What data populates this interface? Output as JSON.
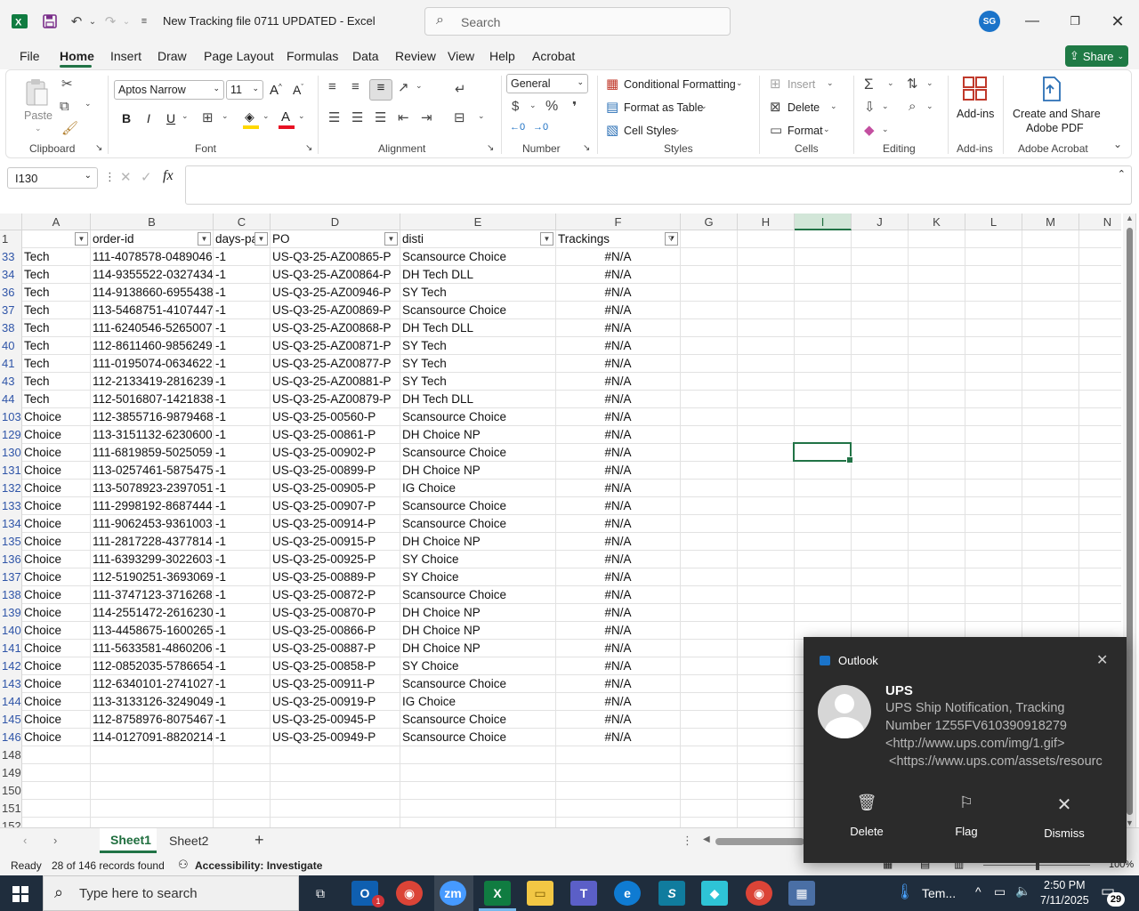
{
  "window": {
    "title": "New Tracking file 0711 UPDATED  -  Excel",
    "search_placeholder": "Search",
    "user_initials": "SG"
  },
  "menu": {
    "tabs": [
      "File",
      "Home",
      "Insert",
      "Draw",
      "Page Layout",
      "Formulas",
      "Data",
      "Review",
      "View",
      "Help",
      "Acrobat"
    ],
    "share_label": "Share"
  },
  "ribbon": {
    "clipboard": {
      "paste": "Paste",
      "label": "Clipboard"
    },
    "font": {
      "name": "Aptos Narrow",
      "size": "11",
      "label": "Font",
      "bold": "B",
      "italic": "I",
      "underline": "U"
    },
    "alignment": {
      "label": "Alignment"
    },
    "number": {
      "format": "General",
      "label": "Number"
    },
    "styles": {
      "conditional": "Conditional Formatting",
      "format_table": "Format as Table",
      "cell_styles": "Cell Styles",
      "label": "Styles"
    },
    "cells": {
      "insert": "Insert",
      "delete": "Delete",
      "format": "Format",
      "label": "Cells"
    },
    "editing": {
      "label": "Editing"
    },
    "addins": {
      "button": "Add-ins",
      "label": "Add-ins"
    },
    "acrobat": {
      "button_line1": "Create and Share",
      "button_line2": "Adobe PDF",
      "label": "Adobe Acrobat"
    }
  },
  "formula_bar": {
    "name_box": "I130",
    "fx": "fx",
    "value": ""
  },
  "grid": {
    "columns": [
      "A",
      "B",
      "C",
      "D",
      "E",
      "F",
      "G",
      "H",
      "I",
      "J",
      "K",
      "L",
      "M",
      "N"
    ],
    "selected_column": "I",
    "header_row": {
      "row": "1",
      "A": "",
      "B": "order-id",
      "C": "days-pa",
      "D": "PO",
      "E": "disti",
      "F": "Trackings"
    },
    "rows": [
      {
        "n": "33",
        "a": "Tech",
        "b": "111-4078578-0489046",
        "c": "-1",
        "d": "US-Q3-25-AZ00865-P",
        "e": "Scansource Choice",
        "f": "#N/A"
      },
      {
        "n": "34",
        "a": "Tech",
        "b": "114-9355522-0327434",
        "c": "-1",
        "d": "US-Q3-25-AZ00864-P",
        "e": "DH Tech DLL",
        "f": "#N/A"
      },
      {
        "n": "36",
        "a": "Tech",
        "b": "114-9138660-6955438",
        "c": "-1",
        "d": "US-Q3-25-AZ00946-P",
        "e": "SY Tech",
        "f": "#N/A"
      },
      {
        "n": "37",
        "a": "Tech",
        "b": "113-5468751-4107447",
        "c": "-1",
        "d": "US-Q3-25-AZ00869-P",
        "e": "Scansource Choice",
        "f": "#N/A"
      },
      {
        "n": "38",
        "a": "Tech",
        "b": "111-6240546-5265007",
        "c": "-1",
        "d": "US-Q3-25-AZ00868-P",
        "e": "DH Tech DLL",
        "f": "#N/A"
      },
      {
        "n": "40",
        "a": "Tech",
        "b": "112-8611460-9856249",
        "c": "-1",
        "d": "US-Q3-25-AZ00871-P",
        "e": "SY Tech",
        "f": "#N/A"
      },
      {
        "n": "41",
        "a": "Tech",
        "b": "111-0195074-0634622",
        "c": "-1",
        "d": "US-Q3-25-AZ00877-P",
        "e": "SY Tech",
        "f": "#N/A"
      },
      {
        "n": "43",
        "a": "Tech",
        "b": "112-2133419-2816239",
        "c": "-1",
        "d": "US-Q3-25-AZ00881-P",
        "e": "SY Tech",
        "f": "#N/A"
      },
      {
        "n": "44",
        "a": "Tech",
        "b": "112-5016807-1421838",
        "c": "-1",
        "d": "US-Q3-25-AZ00879-P",
        "e": "DH Tech DLL",
        "f": "#N/A"
      },
      {
        "n": "103",
        "a": "Choice",
        "b": "112-3855716-9879468",
        "c": "-1",
        "d": "US-Q3-25-00560-P",
        "e": "Scansource Choice",
        "f": "#N/A"
      },
      {
        "n": "129",
        "a": "Choice",
        "b": "113-3151132-6230600",
        "c": "-1",
        "d": "US-Q3-25-00861-P",
        "e": "DH Choice NP",
        "f": "#N/A"
      },
      {
        "n": "130",
        "a": "Choice",
        "b": "111-6819859-5025059",
        "c": "-1",
        "d": "US-Q3-25-00902-P",
        "e": "Scansource Choice",
        "f": "#N/A"
      },
      {
        "n": "131",
        "a": "Choice",
        "b": "113-0257461-5875475",
        "c": "-1",
        "d": "US-Q3-25-00899-P",
        "e": "DH Choice NP",
        "f": "#N/A"
      },
      {
        "n": "132",
        "a": "Choice",
        "b": "113-5078923-2397051",
        "c": "-1",
        "d": "US-Q3-25-00905-P",
        "e": "IG Choice",
        "f": "#N/A"
      },
      {
        "n": "133",
        "a": "Choice",
        "b": "111-2998192-8687444",
        "c": "-1",
        "d": "US-Q3-25-00907-P",
        "e": "Scansource Choice",
        "f": "#N/A"
      },
      {
        "n": "134",
        "a": "Choice",
        "b": "111-9062453-9361003",
        "c": "-1",
        "d": "US-Q3-25-00914-P",
        "e": "Scansource Choice",
        "f": "#N/A"
      },
      {
        "n": "135",
        "a": "Choice",
        "b": "111-2817228-4377814",
        "c": "-1",
        "d": "US-Q3-25-00915-P",
        "e": "DH Choice NP",
        "f": "#N/A"
      },
      {
        "n": "136",
        "a": "Choice",
        "b": "111-6393299-3022603",
        "c": "-1",
        "d": "US-Q3-25-00925-P",
        "e": "SY Choice",
        "f": "#N/A"
      },
      {
        "n": "137",
        "a": "Choice",
        "b": "112-5190251-3693069",
        "c": "-1",
        "d": "US-Q3-25-00889-P",
        "e": "SY Choice",
        "f": "#N/A"
      },
      {
        "n": "138",
        "a": "Choice",
        "b": "111-3747123-3716268",
        "c": "-1",
        "d": "US-Q3-25-00872-P",
        "e": "Scansource Choice",
        "f": "#N/A"
      },
      {
        "n": "139",
        "a": "Choice",
        "b": "114-2551472-2616230",
        "c": "-1",
        "d": "US-Q3-25-00870-P",
        "e": "DH Choice NP",
        "f": "#N/A"
      },
      {
        "n": "140",
        "a": "Choice",
        "b": "113-4458675-1600265",
        "c": "-1",
        "d": "US-Q3-25-00866-P",
        "e": "DH Choice NP",
        "f": "#N/A"
      },
      {
        "n": "141",
        "a": "Choice",
        "b": "111-5633581-4860206",
        "c": "-1",
        "d": "US-Q3-25-00887-P",
        "e": "DH Choice NP",
        "f": "#N/A"
      },
      {
        "n": "142",
        "a": "Choice",
        "b": "112-0852035-5786654",
        "c": "-1",
        "d": "US-Q3-25-00858-P",
        "e": "SY Choice",
        "f": "#N/A"
      },
      {
        "n": "143",
        "a": "Choice",
        "b": "112-6340101-2741027",
        "c": "-1",
        "d": "US-Q3-25-00911-P",
        "e": "Scansource Choice",
        "f": "#N/A"
      },
      {
        "n": "144",
        "a": "Choice",
        "b": "113-3133126-3249049",
        "c": "-1",
        "d": "US-Q3-25-00919-P",
        "e": "IG Choice",
        "f": "#N/A"
      },
      {
        "n": "145",
        "a": "Choice",
        "b": "112-8758976-8075467",
        "c": "-1",
        "d": "US-Q3-25-00945-P",
        "e": "Scansource Choice",
        "f": "#N/A"
      },
      {
        "n": "146",
        "a": "Choice",
        "b": "114-0127091-8820214",
        "c": "-1",
        "d": "US-Q3-25-00949-P",
        "e": "Scansource Choice",
        "f": "#N/A"
      }
    ],
    "empty_rows": [
      "148",
      "149",
      "150",
      "151",
      "152"
    ]
  },
  "sheets": {
    "tabs": [
      "Sheet1",
      "Sheet2"
    ],
    "active": "Sheet1"
  },
  "status": {
    "mode": "Ready",
    "records": "28 of 146 records found",
    "accessibility": "Accessibility: Investigate",
    "zoom": "100%"
  },
  "toast": {
    "app": "Outlook",
    "sender": "UPS",
    "line1": "UPS Ship Notification, Tracking",
    "line2": "Number 1Z55FV610390918279",
    "line3": "<http://www.ups.com/img/1.gif>",
    "line4": "<https://www.ups.com/assets/resourc",
    "actions": [
      "Delete",
      "Flag",
      "Dismiss"
    ]
  },
  "taskbar": {
    "search_placeholder": "Type here to search",
    "weather": "Tem...",
    "time": "2:50 PM",
    "date": "7/11/2025",
    "notifications": "29",
    "outlook_badge": "1"
  },
  "colors": {
    "excel_green": "#217346",
    "share_green": "#1f7a45",
    "row_number_blue": "#2f55a8",
    "taskbar": "#1f2d3d",
    "toast_bg": "#2b2b2b"
  }
}
